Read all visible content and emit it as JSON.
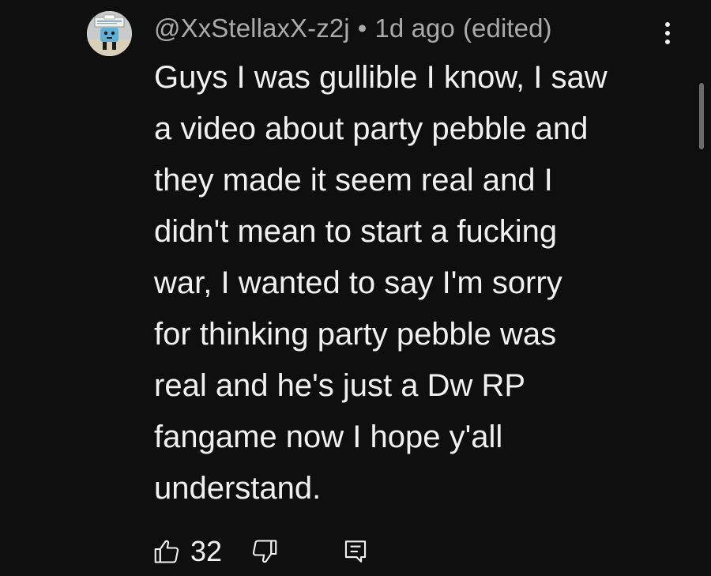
{
  "comment": {
    "author": "@XxStellaxX-z2j",
    "separator": "•",
    "timestamp": "1d ago",
    "edited": "(edited)",
    "lines": [
      "Guys I was gullible I know, I saw",
      "a video about party pebble and",
      "they made it seem real and I",
      "didn't mean to start a fucking",
      "war, I wanted to say I'm sorry",
      "for thinking party pebble was",
      "real and he's just a Dw RP",
      "fangame now I hope y'all",
      "understand."
    ],
    "like_count": "32"
  },
  "icons": {
    "avatar": "avatar-icon",
    "more": "more-vert-icon",
    "like": "thumbs-up-icon",
    "dislike": "thumbs-down-icon",
    "reply": "reply-comment-icon"
  },
  "colors": {
    "background": "#0f0f0f",
    "text_primary": "#f1f1f1",
    "text_secondary": "#aaaaaa",
    "scrollbar": "#6b6b6b"
  }
}
